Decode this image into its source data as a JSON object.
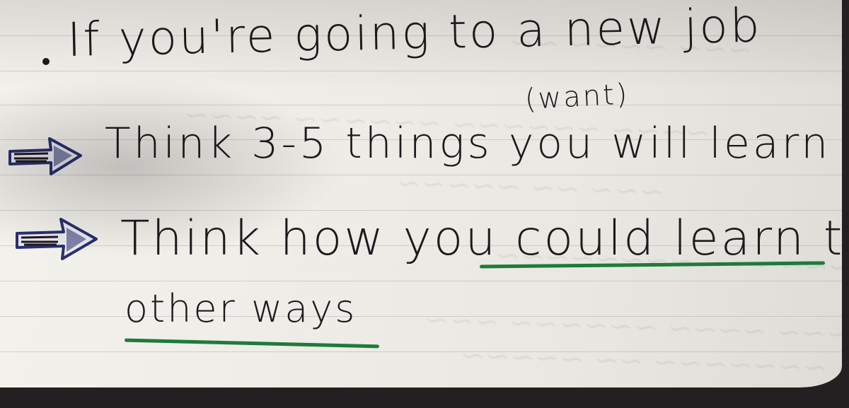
{
  "notes": {
    "line1": "If you're going to a new job",
    "line2_annotation": "(want)",
    "line2": "Think 3-5 things you will learn",
    "line3": "Think how you could learn them",
    "line4": "other ways"
  },
  "colors": {
    "ink": "#1c1a1d",
    "underline": "#1f7a3a",
    "arrow_outline": "#2a2f6e",
    "paper": "#f1efea"
  },
  "icons": [
    "arrow-right-icon",
    "arrow-right-icon"
  ]
}
